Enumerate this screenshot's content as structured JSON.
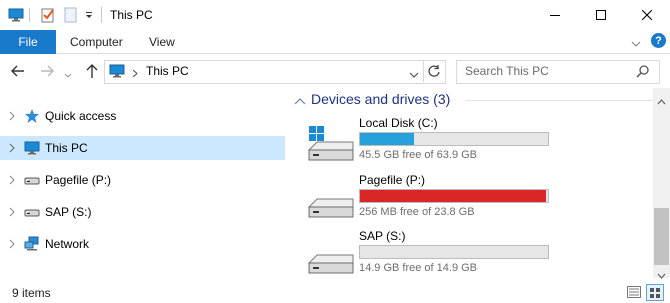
{
  "window": {
    "title": "This PC"
  },
  "ribbon": {
    "tabs": [
      "File",
      "Computer",
      "View"
    ]
  },
  "address": {
    "path": "This PC",
    "search_placeholder": "Search This PC"
  },
  "nav": {
    "items": [
      {
        "label": "Quick access",
        "icon": "star-icon"
      },
      {
        "label": "This PC",
        "icon": "computer-icon",
        "selected": true
      },
      {
        "label": "Pagefile (P:)",
        "icon": "drive-icon"
      },
      {
        "label": "SAP (S:)",
        "icon": "drive-icon"
      },
      {
        "label": "Network",
        "icon": "network-icon"
      }
    ]
  },
  "content": {
    "group_title": "Devices and drives (3)",
    "drives": [
      {
        "name": "Local Disk (C:)",
        "free_text": "45.5 GB free of 63.9 GB",
        "used_fraction": 0.288,
        "bar_color": "#26a0da",
        "icon": "windows-drive-icon"
      },
      {
        "name": "Pagefile (P:)",
        "free_text": "256 MB free of 23.8 GB",
        "used_fraction": 0.99,
        "bar_color": "#da2626",
        "icon": "drive-icon"
      },
      {
        "name": "SAP (S:)",
        "free_text": "14.9 GB free of 14.9 GB",
        "used_fraction": 0.0,
        "bar_color": "#26a0da",
        "icon": "drive-icon"
      }
    ]
  },
  "status": {
    "item_count": "9 items"
  }
}
